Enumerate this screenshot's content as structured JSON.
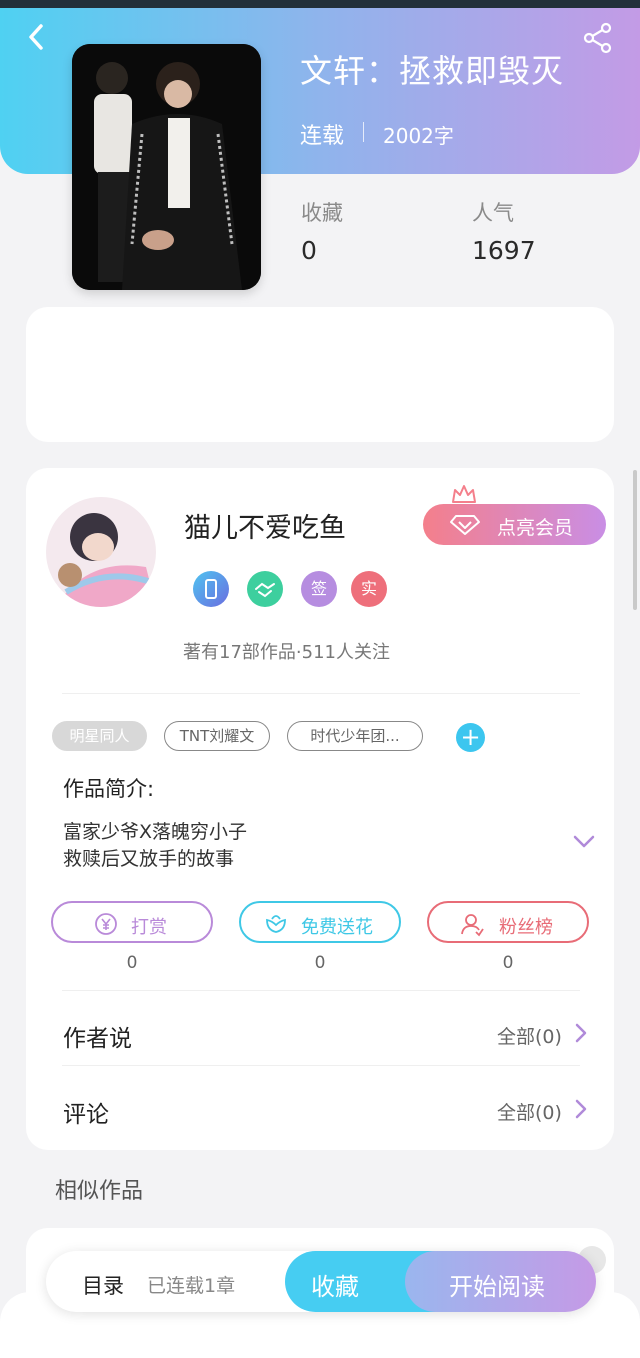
{
  "header": {
    "title": "文轩：拯救即毁灭",
    "status": "连载",
    "word_count": "2002字"
  },
  "stats": {
    "favorites_label": "收藏",
    "favorites_value": "0",
    "popularity_label": "人气",
    "popularity_value": "1697"
  },
  "author": {
    "name": "猫儿不爱吃鱼",
    "vip_button": "点亮会员",
    "badges": [
      "",
      "",
      "签",
      "实"
    ],
    "works_info": "著有17部作品·511人关注"
  },
  "tags": [
    "明星同人",
    "TNT刘耀文",
    "时代少年团..."
  ],
  "intro": {
    "heading": "作品简介:",
    "lines": [
      "富家少爷X落魄穷小子",
      "救赎后又放手的故事"
    ]
  },
  "actions": [
    {
      "label": "打赏",
      "count": "0",
      "color": "#b98ad9"
    },
    {
      "label": "免费送花",
      "count": "0",
      "color": "#3fc8e6"
    },
    {
      "label": "粉丝榜",
      "count": "0",
      "color": "#e86c77"
    }
  ],
  "sections": {
    "author_says": "作者说",
    "author_says_all": "全部(0)",
    "comments": "评论",
    "comments_all": "全部(0)",
    "similar": "相似作品"
  },
  "bottom": {
    "toc": "目录",
    "chapters": "已连载1章",
    "favorite_button": "收藏",
    "read_button": "开始阅读"
  },
  "icons": {
    "back": "chevron-left-icon",
    "share": "share-icon",
    "expand": "chevron-down-icon",
    "yen": "yen-icon",
    "flower": "flower-icon",
    "fans": "user-icon"
  },
  "colors": {
    "brand_cyan": "#46cdf2",
    "brand_purple": "#c59ae6",
    "vip_red": "#f47f8b"
  }
}
